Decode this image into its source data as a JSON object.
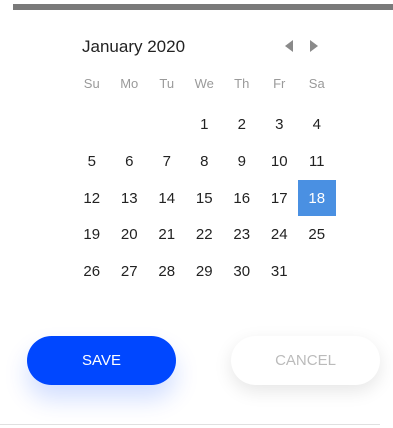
{
  "calendar": {
    "title": "January 2020",
    "weekdays": [
      "Su",
      "Mo",
      "Tu",
      "We",
      "Th",
      "Fr",
      "Sa"
    ],
    "weeks": [
      [
        "",
        "",
        "",
        "1",
        "2",
        "3",
        "4"
      ],
      [
        "5",
        "6",
        "7",
        "8",
        "9",
        "10",
        "11"
      ],
      [
        "12",
        "13",
        "14",
        "15",
        "16",
        "17",
        "18"
      ],
      [
        "19",
        "20",
        "21",
        "22",
        "23",
        "24",
        "25"
      ],
      [
        "26",
        "27",
        "28",
        "29",
        "30",
        "31",
        ""
      ]
    ],
    "selected_day": "18",
    "selected_color": "#4a90e2"
  },
  "actions": {
    "save_label": "SAVE",
    "cancel_label": "CANCEL",
    "save_color": "#0047ff"
  }
}
